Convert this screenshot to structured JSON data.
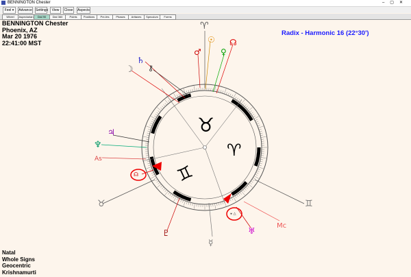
{
  "window": {
    "title": "BENNINGTON Chester"
  },
  "menu": [
    "Feel ▾",
    "Advance ▾",
    "Settings",
    "View ▾",
    "Close",
    "Aspects ▾"
  ],
  "tabs": [
    "Wheel",
    "Aspectarian",
    "Dial 90",
    "Dial 360",
    "Points",
    "Positions",
    "Pre-fes",
    "Phases",
    "Arttaxes",
    "Speculum",
    "Forms"
  ],
  "active_tab": 2,
  "info": {
    "name": "BENNINGTON Chester",
    "place": "Phoenix, AZ",
    "date": "Mar 20 1976",
    "time": "22:41:00  MST"
  },
  "chart_title": "Radix - Harmonic 16 (22°30')",
  "footer": {
    "type": "Natal",
    "signs": "Whole Signs",
    "center": "Geocentric",
    "ayanamsa": "Krishnamurti"
  },
  "colors": {
    "title_blue": "#1a1aff",
    "highlight_red": "#e00000",
    "background": "#fdf5ec"
  },
  "wheel_glyphs": {
    "sign_taurus": "♉",
    "sign_aries": "♈",
    "sign_gemini": "♊"
  },
  "planets": {
    "ascendant": "♈",
    "sun": "☉",
    "mars": "♂",
    "venus": "♀",
    "chiron": "☊",
    "moon": "☽",
    "saturn": "♄",
    "uranus_top": "⚷",
    "jupiter": "♃",
    "neptune": "♆",
    "as": "As",
    "north_node": "☊",
    "mc": "Mc",
    "taurus_left": "♉",
    "gemini_right": "♊",
    "pluto": "♇",
    "mercury": "☿",
    "uranus": "♅"
  }
}
